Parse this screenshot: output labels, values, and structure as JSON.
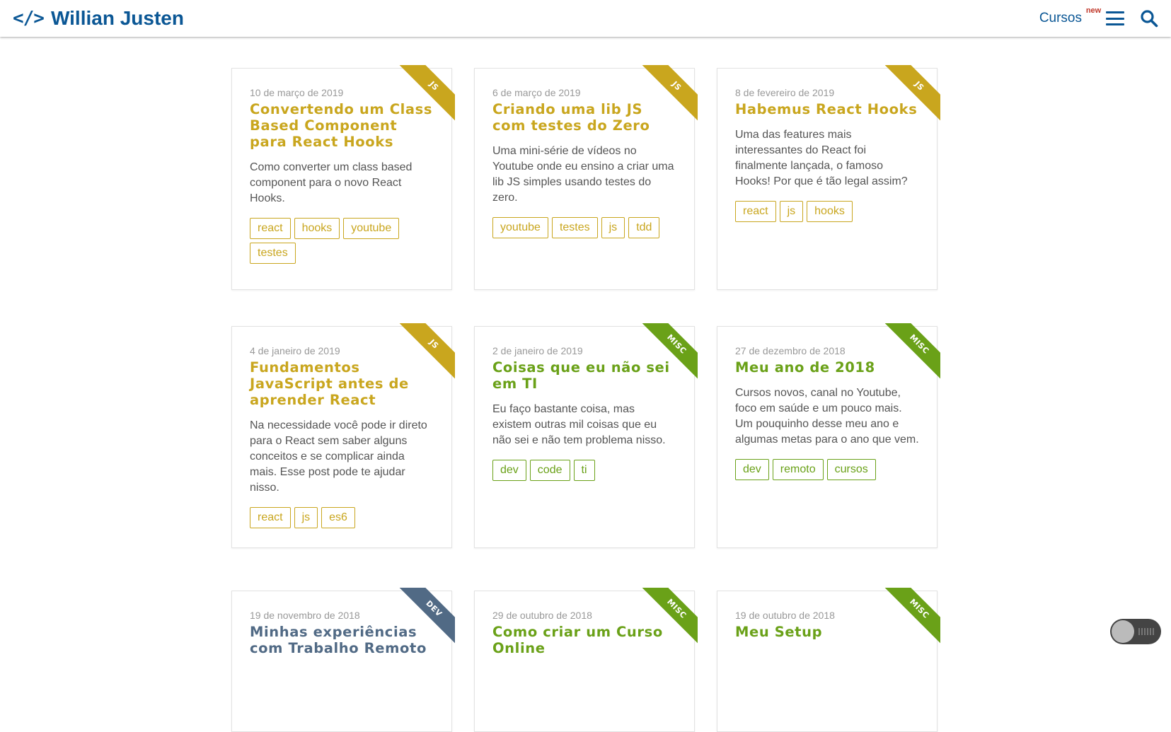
{
  "header": {
    "logo_code": "</>",
    "logo_name": "Willian Justen",
    "cursos_label": "Cursos",
    "cursos_badge": "new"
  },
  "colors": {
    "brand": "#0b5795",
    "js": "#c9a61e",
    "misc": "#6aa118",
    "dev": "#516a85"
  },
  "posts": [
    {
      "category": "JS",
      "date": "10 de março de 2019",
      "title": "Convertendo um Class Based Component para React Hooks",
      "description": "Como converter um class based component para o novo React Hooks.",
      "tags": [
        "react",
        "hooks",
        "youtube",
        "testes"
      ]
    },
    {
      "category": "JS",
      "date": "6 de março de 2019",
      "title": "Criando uma lib JS com testes do Zero",
      "description": "Uma mini-série de vídeos no Youtube onde eu ensino a criar uma lib JS simples usando testes do zero.",
      "tags": [
        "youtube",
        "testes",
        "js",
        "tdd"
      ]
    },
    {
      "category": "JS",
      "date": "8 de fevereiro de 2019",
      "title": "Habemus React Hooks",
      "description": "Uma das features mais interessantes do React foi finalmente lançada, o famoso Hooks! Por que é tão legal assim?",
      "tags": [
        "react",
        "js",
        "hooks"
      ]
    },
    {
      "category": "JS",
      "date": "4 de janeiro de 2019",
      "title": "Fundamentos JavaScript antes de aprender React",
      "description": "Na necessidade você pode ir direto para o React sem saber alguns conceitos e se complicar ainda mais. Esse post pode te ajudar nisso.",
      "tags": [
        "react",
        "js",
        "es6"
      ]
    },
    {
      "category": "MISC",
      "date": "2 de janeiro de 2019",
      "title": "Coisas que eu não sei em TI",
      "description": "Eu faço bastante coisa, mas existem outras mil coisas que eu não sei e não tem problema nisso.",
      "tags": [
        "dev",
        "code",
        "ti"
      ]
    },
    {
      "category": "MISC",
      "date": "27 de dezembro de 2018",
      "title": "Meu ano de 2018",
      "description": "Cursos novos, canal no Youtube, foco em saúde e um pouco mais. Um pouquinho desse meu ano e algumas metas para o ano que vem.",
      "tags": [
        "dev",
        "remoto",
        "cursos"
      ]
    },
    {
      "category": "DEV",
      "date": "19 de novembro de 2018",
      "title": "Minhas experiências com Trabalho Remoto",
      "description": "",
      "tags": []
    },
    {
      "category": "MISC",
      "date": "29 de outubro de 2018",
      "title": "Como criar um Curso Online",
      "description": "",
      "tags": []
    },
    {
      "category": "MISC",
      "date": "19 de outubro de 2018",
      "title": "Meu Setup",
      "description": "",
      "tags": []
    }
  ]
}
